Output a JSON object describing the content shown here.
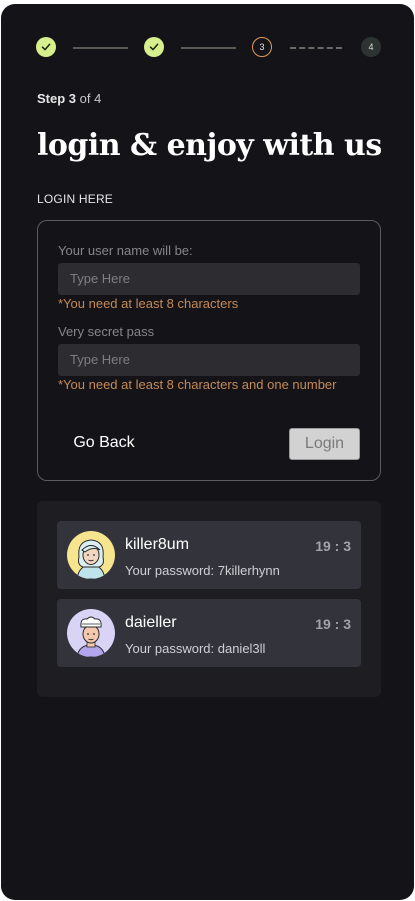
{
  "stepper": {
    "steps": [
      {
        "label": "",
        "state": "done"
      },
      {
        "label": "",
        "state": "done"
      },
      {
        "label": "3",
        "state": "current"
      },
      {
        "label": "4",
        "state": "pending"
      }
    ],
    "step_prefix": "Step",
    "current_step": "3",
    "step_suffix": "of 4"
  },
  "page": {
    "title": "login & enjoy with us",
    "section_label": "LOGIN HERE"
  },
  "form": {
    "username_label": "Your user name will be:",
    "username_placeholder": "Type Here",
    "username_error": "*You need at least 8 characters",
    "password_label": "Very secret pass",
    "password_placeholder": "Type Here",
    "password_error": "*You need at least 8 characters and one number",
    "back_label": "Go Back",
    "login_label": "Login"
  },
  "accounts": [
    {
      "username": "killer8um",
      "time": "19 : 3",
      "password_text": "Your password: 7killerhynn",
      "avatar": "woman-avatar"
    },
    {
      "username": "daieller",
      "time": "19 : 3",
      "password_text": "Your password: daniel3ll",
      "avatar": "man-chef-avatar"
    }
  ],
  "colors": {
    "background": "#141318",
    "step_done": "#d7ef8c",
    "step_current_border": "#e09a5a",
    "error_text": "#c58a56",
    "card": "#33333c"
  }
}
